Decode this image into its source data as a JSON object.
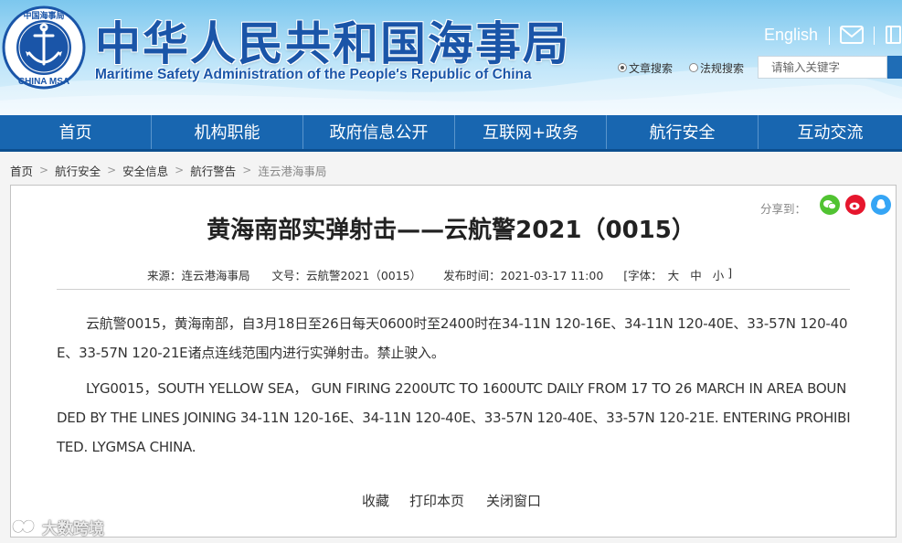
{
  "header": {
    "logo_ring_text": "中国海事局",
    "logo_bottom_text": "CHINA MSA",
    "title_cn": "中华人民共和国海事局",
    "title_en": "Maritime Safety Administration of the People's Republic of China",
    "lang_link": "English",
    "search_options": [
      {
        "label": "文章搜索",
        "checked": true
      },
      {
        "label": "法规搜索",
        "checked": false
      }
    ],
    "search_placeholder": "请输入关键字"
  },
  "nav": {
    "items": [
      "首页",
      "机构职能",
      "政府信息公开",
      "互联网+政务",
      "航行安全",
      "互动交流"
    ]
  },
  "breadcrumb": {
    "items": [
      "首页",
      "航行安全",
      "安全信息",
      "航行警告",
      "连云港海事局"
    ],
    "separator": ">"
  },
  "share": {
    "label": "分享到：",
    "icons": [
      "wechat-icon",
      "weibo-icon",
      "qq-icon"
    ],
    "colors": {
      "wechat": "#51c332",
      "weibo": "#e6162d",
      "qq": "#35a5f5"
    }
  },
  "article": {
    "title": "黄海南部实弹射击——云航警2021（0015）",
    "meta": {
      "source": "来源：连云港海事局",
      "doc_no": "文号：云航警2021（0015）",
      "publish_time": "发布时间：2021-03-17 11:00",
      "font_label": "[字体：",
      "font_large": "大",
      "font_medium": "中",
      "font_small": "小",
      "font_close": "]"
    },
    "paragraph_cn": "云航警0015，黄海南部，自3月18日至26日每天0600时至2400时在34-11N 120-16E、34-11N  120-40E、33-57N 120-40E、33-57N 120-21E诸点连线范围内进行实弹射击。禁止驶入。",
    "paragraph_en": "LYG0015，SOUTH YELLOW SEA， GUN FIRING 2200UTC TO 1600UTC DAILY FROM 17 TO 26 MARCH IN AREA BOUNDED BY THE LINES JOINING 34-11N  120-16E、34-11N  120-40E、33-57N 120-40E、33-57N  120-21E. ENTERING PROHIBITED. LYGMSA CHINA."
  },
  "actions": {
    "favorite": "收藏",
    "print": "打印本页",
    "close": "关闭窗口"
  },
  "watermark": {
    "text": "大数跨境"
  },
  "colors": {
    "brand_blue": "#1a55a8",
    "nav_blue": "#1866b0",
    "header_light": "#bfe5f9"
  }
}
